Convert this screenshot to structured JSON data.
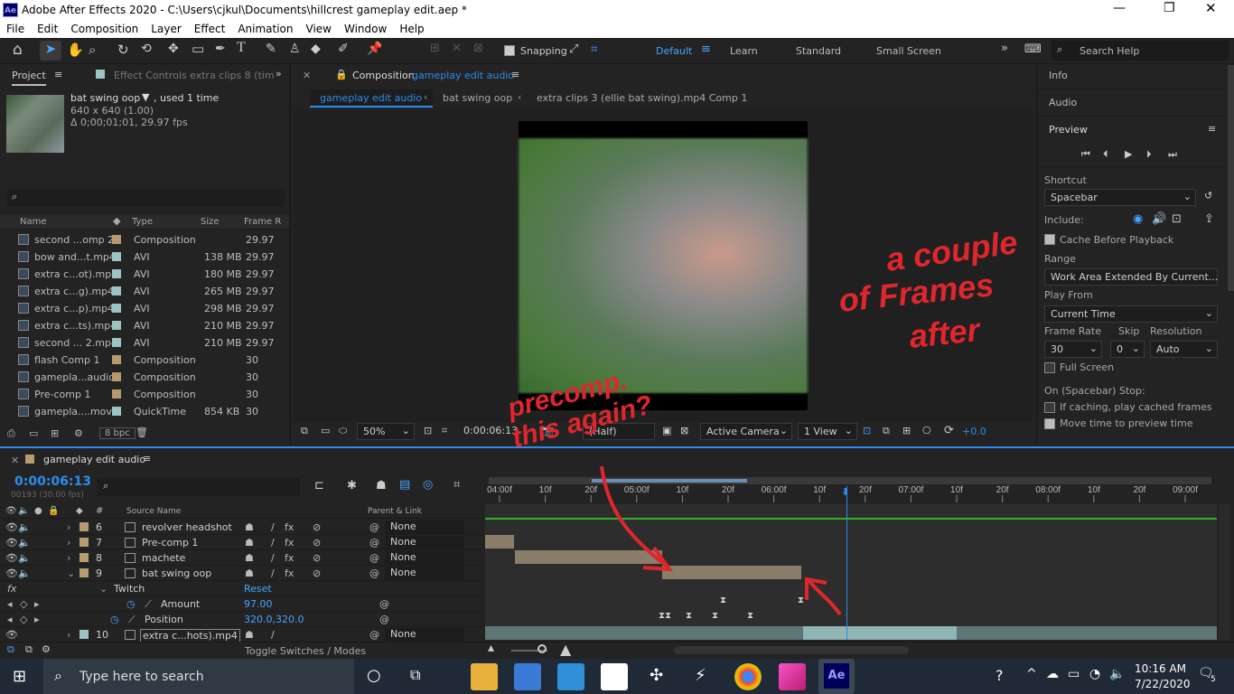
{
  "window": {
    "title": "Adobe After Effects 2020 - C:\\Users\\cjkul\\Documents\\hillcrest gameplay edit.aep *",
    "ae_badge": "Ae"
  },
  "menu": [
    "File",
    "Edit",
    "Composition",
    "Layer",
    "Effect",
    "Animation",
    "View",
    "Window",
    "Help"
  ],
  "toolbar": {
    "snapping": "Snapping",
    "workspaces": [
      "Default",
      "Learn",
      "Standard",
      "Small Screen"
    ],
    "active_workspace": "Default",
    "search_placeholder": "Search Help"
  },
  "project": {
    "tab": "Project",
    "effect_controls_tab": "Effect Controls extra clips 8 (tim",
    "item_name": "bat swing oop",
    "used": ", used 1 time",
    "dims": "640 x 640 (1.00)",
    "duration": "Δ 0;00;01;01, 29.97 fps",
    "columns": [
      "Name",
      "Type",
      "Size",
      "Frame R"
    ],
    "rows": [
      {
        "name": "second ...omp 2",
        "type": "Composition",
        "size": "",
        "fr": "29.97",
        "color": "#b89a6f"
      },
      {
        "name": "bow and...t.mp4",
        "type": "AVI",
        "size": "138 MB",
        "fr": "29.97",
        "color": "#9cc4c4"
      },
      {
        "name": "extra c...ot).mp4",
        "type": "AVI",
        "size": "180 MB",
        "fr": "29.97",
        "color": "#9cc4c4"
      },
      {
        "name": "extra c...g).mp4",
        "type": "AVI",
        "size": "265 MB",
        "fr": "29.97",
        "color": "#9cc4c4"
      },
      {
        "name": "extra c...p).mp4",
        "type": "AVI",
        "size": "298 MB",
        "fr": "29.97",
        "color": "#9cc4c4"
      },
      {
        "name": "extra c...ts).mp4",
        "type": "AVI",
        "size": "210 MB",
        "fr": "29.97",
        "color": "#9cc4c4"
      },
      {
        "name": "second ... 2.mp4",
        "type": "AVI",
        "size": "210 MB",
        "fr": "29.97",
        "color": "#9cc4c4"
      },
      {
        "name": "flash Comp 1",
        "type": "Composition",
        "size": "",
        "fr": "30",
        "color": "#b89a6f"
      },
      {
        "name": "gamepla...audio",
        "type": "Composition",
        "size": "",
        "fr": "30",
        "color": "#b89a6f"
      },
      {
        "name": "Pre-comp 1",
        "type": "Composition",
        "size": "",
        "fr": "30",
        "color": "#b89a6f"
      },
      {
        "name": "gamepla....mov",
        "type": "QuickTime",
        "size": "854 KB",
        "fr": "30",
        "color": "#9cc4c4"
      }
    ],
    "bpc": "8 bpc"
  },
  "composition": {
    "tab_prefix": "Composition",
    "tab_name": "gameplay edit audio",
    "breadcrumbs": [
      "gameplay edit audio",
      "bat swing oop",
      "extra clips 3 (ellie bat swing).mp4 Comp 1"
    ],
    "zoom": "50%",
    "timecode": "0:00:06:13",
    "resolution": "(Half)",
    "camera": "Active Camera",
    "views": "1 View",
    "exposure": "+0.0"
  },
  "right": {
    "info": "Info",
    "audio": "Audio",
    "preview": "Preview",
    "shortcut_label": "Shortcut",
    "shortcut": "Spacebar",
    "include_label": "Include:",
    "cache_before": "Cache Before Playback",
    "range_label": "Range",
    "range": "Work Area Extended By Current...",
    "play_from_label": "Play From",
    "play_from": "Current Time",
    "frame_rate_label": "Frame Rate",
    "skip_label": "Skip",
    "resolution_label": "Resolution",
    "frame_rate": "30",
    "skip": "0",
    "resolution": "Auto",
    "full_screen": "Full Screen",
    "on_stop": "On (Spacebar) Stop:",
    "if_caching": "If caching, play cached frames",
    "move_time": "Move time to preview time"
  },
  "timeline": {
    "tab": "gameplay edit audio",
    "timecode": "0:00:06:13",
    "frames": "00193 (30.00 fps)",
    "col_source": "Source Name",
    "col_parent": "Parent & Link",
    "ruler": [
      "04:00f",
      "10f",
      "20f",
      "05:00f",
      "10f",
      "20f",
      "06:00f",
      "10f",
      "20f",
      "07:00f",
      "10f",
      "20f",
      "08:00f",
      "10f",
      "20f",
      "09:00f"
    ],
    "layers": [
      {
        "num": "6",
        "name": "revolver headshot",
        "parent": "None"
      },
      {
        "num": "7",
        "name": "Pre-comp 1",
        "parent": "None"
      },
      {
        "num": "8",
        "name": "machete",
        "parent": "None"
      },
      {
        "num": "9",
        "name": "bat swing oop",
        "parent": "None"
      }
    ],
    "effect": "Twitch",
    "reset": "Reset",
    "fx": "fx",
    "amount_label": "Amount",
    "amount": "97.00",
    "position_label": "Position",
    "position": "320.0,320.0",
    "layer10": {
      "num": "10",
      "name": "extra c...hots).mp4",
      "parent": "None"
    },
    "toggle": "Toggle Switches / Modes"
  },
  "annotations": {
    "right": [
      "a couple",
      "of Frames",
      "after"
    ],
    "center": [
      "precomp.",
      "this again?"
    ]
  },
  "taskbar": {
    "search": "Type here to search",
    "time": "10:16 AM",
    "date": "7/22/2020",
    "notif": "5"
  }
}
